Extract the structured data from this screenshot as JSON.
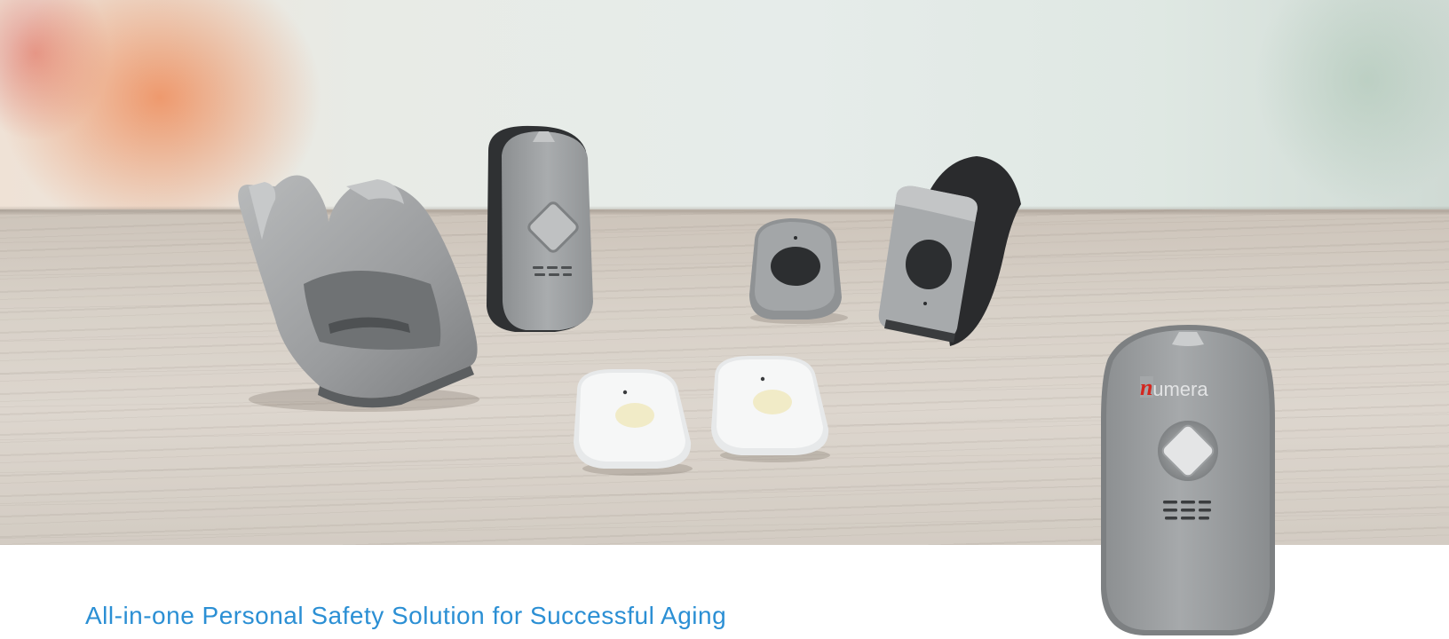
{
  "hero": {
    "brand_logo_text": "numera"
  },
  "caption": {
    "headline": "All-in-one Personal Safety Solution for Successful Aging"
  },
  "colors": {
    "headline": "#2b8fd4",
    "device_gray": "#9a9d9f",
    "logo_red": "#d3271f"
  }
}
